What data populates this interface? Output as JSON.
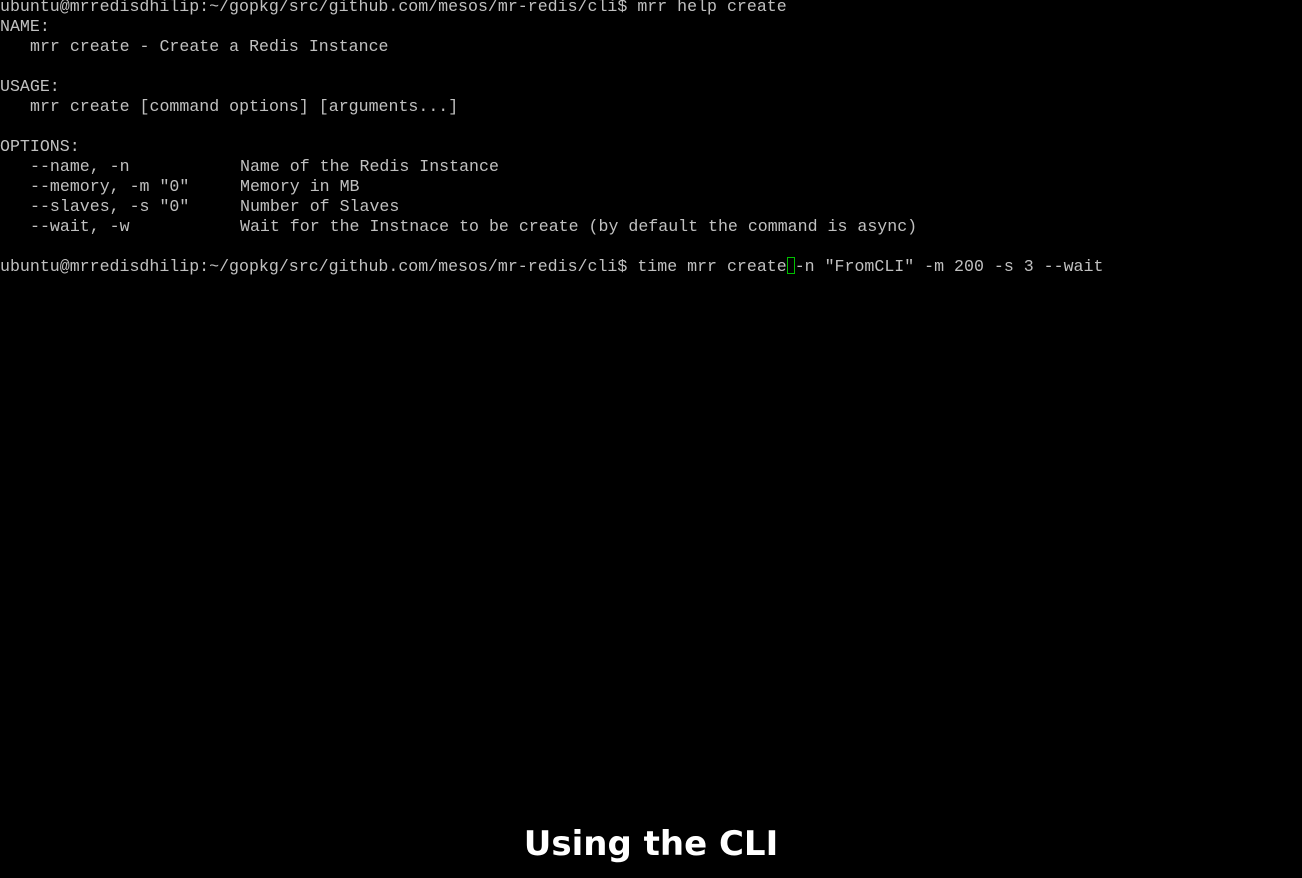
{
  "terminal": {
    "prompt": "ubuntu@mrredisdhilip:~/gopkg/src/github.com/mesos/mr-redis/cli$",
    "first_command": "mrr help create",
    "name_header": "NAME:",
    "name_text": "mrr create - Create a Redis Instance",
    "usage_header": "USAGE:",
    "usage_text": "mrr create [command options] [arguments...]",
    "options_header": "OPTIONS:",
    "options": [
      {
        "flag": "--name, -n",
        "description": "Name of the Redis Instance"
      },
      {
        "flag": "--memory, -m \"0\"",
        "description": "Memory in MB"
      },
      {
        "flag": "--slaves, -s \"0\"",
        "description": "Number of Slaves"
      },
      {
        "flag": "--wait, -w",
        "description": "Wait for the Instnace to be create (by default the command is async)"
      }
    ],
    "second_command_before_cursor": "time mrr create",
    "second_command_after_cursor": "-n \"FromCLI\" -m 200 -s 3 --wait",
    "cursor_color": "#00c000",
    "text_color": "#c0c0c0",
    "background_color": "#000000"
  },
  "caption": {
    "text": "Using the CLI"
  }
}
